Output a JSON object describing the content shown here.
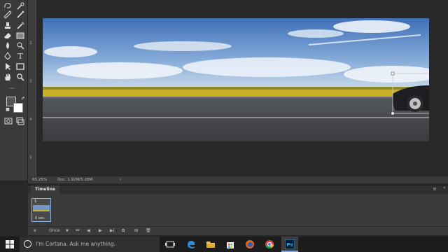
{
  "statusbar": {
    "zoom": "65.25%",
    "doc": "Doc: 1.92M/5.28M",
    "arrow": "›"
  },
  "ruler": {
    "marks": [
      "2",
      "3",
      "4",
      "5"
    ]
  },
  "timeline": {
    "tab_label": "Timeline",
    "close": "«",
    "menu": "≡",
    "frame_number": "1",
    "frame_delay": "0 sec.",
    "loop_option": "Once"
  },
  "taskbar": {
    "search_placeholder": "I'm Cortana. Ask me anything.",
    "accent": "#7aa6d6"
  },
  "colors": {
    "toolbox_bg": "#3a3a3a",
    "workspace_bg": "#282828",
    "panel_bg": "#3b3b3b",
    "taskbar_bg": "#1c1c1c"
  }
}
